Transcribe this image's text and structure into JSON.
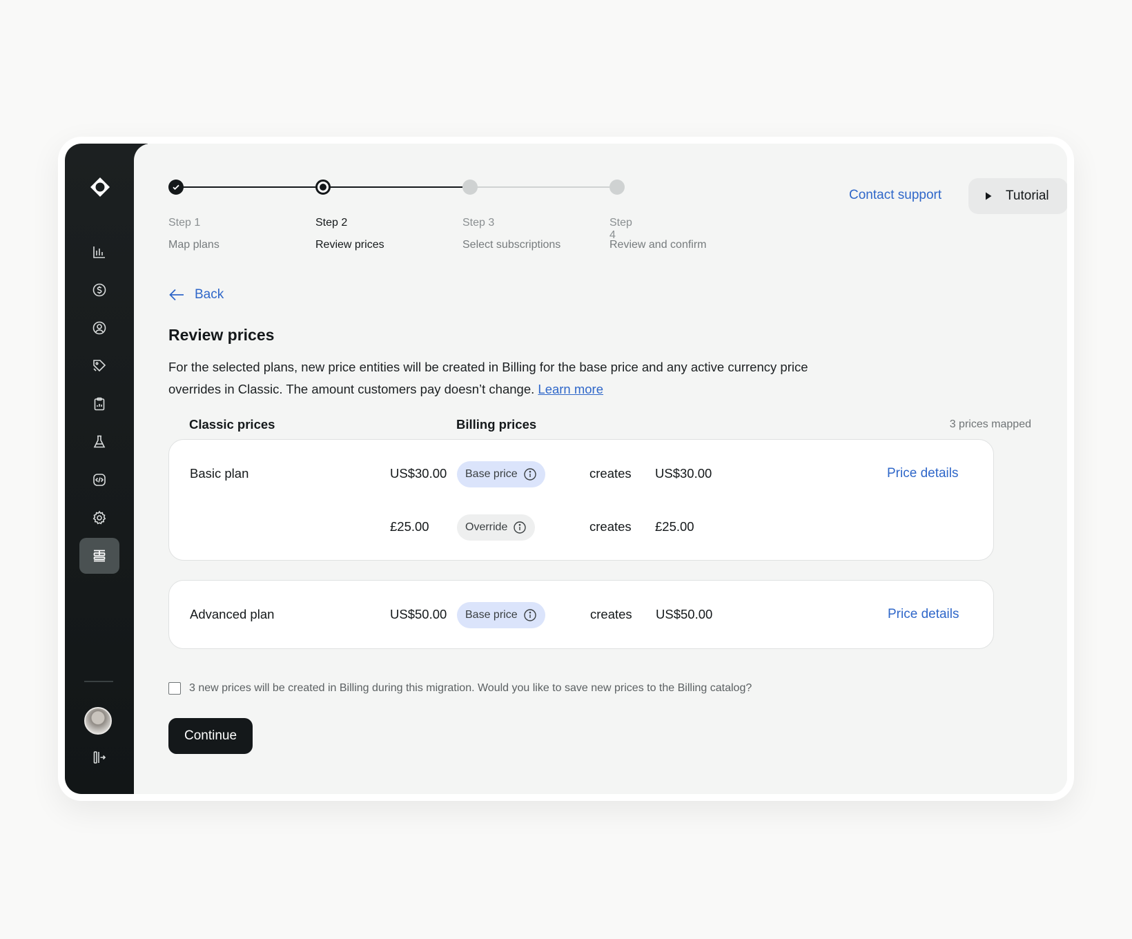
{
  "stepper": {
    "steps": [
      {
        "number": "Step 1",
        "name": "Map plans",
        "state": "done"
      },
      {
        "number": "Step 2",
        "name": "Review prices",
        "state": "current"
      },
      {
        "number": "Step 3",
        "name": "Select subscriptions",
        "state": "todo"
      },
      {
        "number": "Step 4",
        "name": "Review and confirm",
        "state": "todo"
      }
    ]
  },
  "header": {
    "contact_label": "Contact support",
    "tutorial_label": "Tutorial"
  },
  "page": {
    "back_label": "Back",
    "title": "Review prices",
    "description": "For the selected plans, new price entities will be created in Billing for the base price and any active currency price overrides in Classic. The amount customers pay doesn’t change.",
    "learn_more": "Learn more"
  },
  "table": {
    "classic_header": "Classic prices",
    "billing_header": "Billing prices",
    "mapped_count": "3 prices mapped",
    "plans": [
      {
        "name": "Basic plan",
        "details_label": "Price details",
        "rows": [
          {
            "classic": "US$30.00",
            "tag": "Base price",
            "verb": "creates",
            "billing": "US$30.00"
          },
          {
            "classic": "£25.00",
            "tag": "Override",
            "verb": "creates",
            "billing": "£25.00"
          }
        ]
      },
      {
        "name": "Advanced plan",
        "details_label": "Price details",
        "rows": [
          {
            "classic": "US$50.00",
            "tag": "Base price",
            "verb": "creates",
            "billing": "US$50.00"
          }
        ]
      }
    ]
  },
  "footer": {
    "checkbox_label": "3 new prices will be created in Billing during this migration. Would you like to save new prices to the Billing catalog?",
    "checkbox_checked": false,
    "continue_label": "Continue"
  },
  "colors": {
    "accent": "#2f67c9",
    "sidebar": "#14181a",
    "base_tag": "#dbe4fb"
  },
  "sidebar": {
    "icons": [
      "logo-icon",
      "analytics-icon",
      "billing-icon",
      "customers-icon",
      "pricing-icon",
      "reports-icon",
      "experiments-icon",
      "developers-icon",
      "settings-icon",
      "migration-icon",
      "avatar",
      "collapse-icon"
    ],
    "active": "migration-icon"
  }
}
